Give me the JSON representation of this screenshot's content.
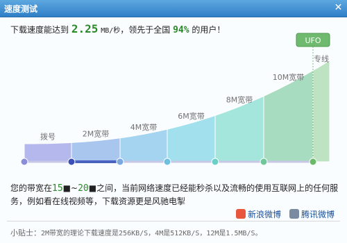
{
  "window": {
    "title": "速度测试",
    "close_glyph": "✕"
  },
  "result": {
    "prefix": "下载速度能达到",
    "speed": "2.25",
    "speed_unit": "MB/秒",
    "middle": "，领先于全国",
    "percent": "94%",
    "suffix": "的用户！"
  },
  "chart": {
    "marker_label": "UFO",
    "bands": [
      "拨号",
      "2M宽带",
      "4M宽带",
      "6M宽带",
      "8M宽带",
      "10M宽带",
      "专线"
    ],
    "current_segment": [
      1,
      2
    ],
    "colors": [
      "#b5b8ec",
      "#a9c6ef",
      "#a4d4f0",
      "#a2e0ee",
      "#a4e6dc",
      "#a8dcc0",
      "#bde3c2"
    ]
  },
  "description": {
    "line1_prefix": "您的带宽在",
    "range_lo": "15",
    "range_hi": "20",
    "line1_suffix": "之间，当前网络速度已经能秒杀以及流畅的使用互联网上的任何服",
    "line2": "务，例如看在线视频等，下载资源更是风驰电掣"
  },
  "share": {
    "sina_label": "新浪微博",
    "tencent_label": "腾讯微博"
  },
  "tip": {
    "label": "小贴士：",
    "text": "2M带宽的理论下载速度是256KB/S，4M是512KB/S，12M是1.5MB/S。"
  }
}
